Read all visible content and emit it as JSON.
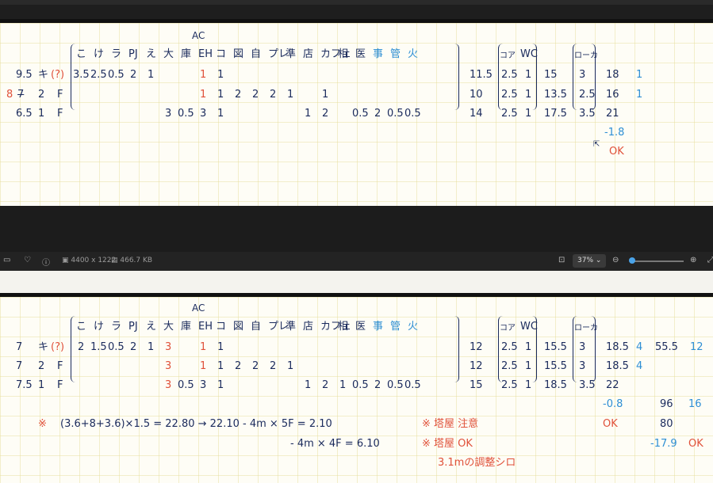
{
  "top_panel": {
    "headers": [
      "こ",
      "け",
      "ラ",
      "PJ",
      "え",
      "大",
      "庫",
      "EH",
      "コ",
      "図",
      "自",
      "プレ",
      "準",
      "店",
      "カフェ",
      "相",
      "医",
      "事",
      "管",
      "火"
    ],
    "header_ac": "AC",
    "right_headers": [
      "コア",
      "WC",
      "ローカ"
    ],
    "rows": [
      {
        "label_a": "9.5",
        "label_b": "キ",
        "label_c": "(?)",
        "values": [
          "3.5",
          "2.5",
          "0.5",
          "2",
          "1",
          "",
          "",
          "1",
          "1"
        ],
        "sum": "11.5",
        "core": "2.5",
        "wc": "1",
        "tot": "15",
        "loc": "3",
        "r1": "18",
        "r2": "1"
      },
      {
        "label_x": "8",
        "label_a": "7",
        "label_b": "2",
        "label_c": "F",
        "values": [
          "",
          "",
          "",
          "",
          "",
          "",
          "",
          "1",
          "1",
          "2",
          "2",
          "2",
          "1",
          "",
          "1"
        ],
        "sum": "10",
        "core": "2.5",
        "wc": "1",
        "tot": "13.5",
        "loc": "2.5",
        "r1": "16",
        "r2": "1"
      },
      {
        "label_a": "6.5",
        "label_b": "1",
        "label_c": "F",
        "values": [
          "",
          "",
          "",
          "",
          "",
          "3",
          "0.5",
          "3",
          "1",
          "",
          "",
          "",
          "",
          "1",
          "2",
          "",
          "0.5",
          "2",
          "0.5",
          "0.5"
        ],
        "sum": "14",
        "core": "2.5",
        "wc": "1",
        "tot": "17.5",
        "loc": "3.5",
        "r1": "21"
      }
    ],
    "diff": "-1.8",
    "ok": "OK"
  },
  "status_bar": {
    "dimensions": "4400 x 1222",
    "file_size": "466.7 KB",
    "zoom": "37%"
  },
  "bottom_panel": {
    "rows": [
      {
        "label_a": "7",
        "label_b": "キ",
        "label_c": "(?)",
        "values": [
          "2",
          "1.5",
          "0.5",
          "2",
          "1",
          "3",
          "",
          "1",
          "1"
        ],
        "sum": "12",
        "core": "2.5",
        "wc": "1",
        "tot": "15.5",
        "loc": "3",
        "r1": "18.5",
        "r2": "4",
        "r3": "55.5",
        "r4": "12"
      },
      {
        "label_a": "7",
        "label_b": "2",
        "label_c": "F",
        "values": [
          "",
          "",
          "",
          "",
          "",
          "3",
          "",
          "1",
          "1",
          "2",
          "2",
          "2",
          "1"
        ],
        "sum": "12",
        "core": "2.5",
        "wc": "1",
        "tot": "15.5",
        "loc": "3",
        "r1": "18.5",
        "r2": "4"
      },
      {
        "label_a": "7.5",
        "label_b": "1",
        "label_c": "F",
        "values": [
          "",
          "",
          "",
          "",
          "",
          "3",
          "0.5",
          "3",
          "1",
          "",
          "",
          "",
          "",
          "1",
          "2",
          "1",
          "0.5",
          "2",
          "0.5",
          "0.5"
        ],
        "sum": "15",
        "core": "2.5",
        "wc": "1",
        "tot": "18.5",
        "loc": "3.5",
        "r1": "22"
      }
    ],
    "diff": "-0.8",
    "ok": "OK",
    "r3_total": "96",
    "r4_total": "16",
    "r3_next": "80",
    "r3_diff": "-17.9",
    "r3_ok": "OK",
    "note_mark": "※",
    "formula1": "(3.6+8+3.6)×1.5 = 22.80 → 22.10 - 4m × 5F = 2.10",
    "warn1": "※ 塔屋 注意",
    "formula2": "- 4m × 4F = 6.10",
    "warn2": "※ 塔屋 OK",
    "note3": "3.1mの調整シロ"
  }
}
